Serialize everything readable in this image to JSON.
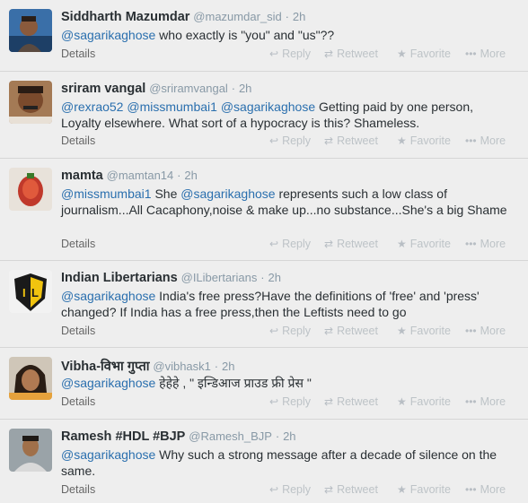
{
  "actions": {
    "details": "Details",
    "reply": "Reply",
    "retweet": "Retweet",
    "favorite": "Favorite",
    "more": "More"
  },
  "tweets": [
    {
      "fullname": "Siddharth Mazumdar",
      "screen": "@mazumdar_sid",
      "sep": "·",
      "time": "2h",
      "mentions": [
        "@sagarikaghose"
      ],
      "body": " who exactly is \"you\" and \"us\"??"
    },
    {
      "fullname": "sriram vangal",
      "screen": "@sriramvangal",
      "sep": "·",
      "time": "2h",
      "mentions": [
        "@rexrao52",
        "@missmumbai1",
        "@sagarikaghose"
      ],
      "body": " Getting paid by one person, Loyalty elsewhere. What sort of a hypocracy is this? Shameless."
    },
    {
      "fullname": "mamta",
      "screen": "@mamtan14",
      "sep": "·",
      "time": "2h",
      "mentions": [
        "@missmumbai1"
      ],
      "body_a": " She ",
      "mention_b": "@sagarikaghose",
      "body": " represents such a low class of journalism...All Cacaphony,noise & make up...no substance...She's a big Shame"
    },
    {
      "fullname": "Indian Libertarians",
      "screen": "@ILibertarians",
      "sep": "·",
      "time": "2h",
      "mentions": [
        "@sagarikaghose"
      ],
      "body": " India's free press?Have the definitions of 'free' and 'press' changed? If India has a free press,then the Leftists need to go"
    },
    {
      "fullname": "Vibha-विभा गुप्ता",
      "screen": "@vibhask1",
      "sep": "·",
      "time": "2h",
      "mentions": [
        "@sagarikaghose"
      ],
      "body": " हेहेहे , \" इन्डिआज प्राउड फ्री प्रेस \""
    },
    {
      "fullname": "Ramesh #HDL #BJP",
      "screen": "@Ramesh_BJP",
      "sep": "·",
      "time": "2h",
      "mentions": [
        "@sagarikaghose"
      ],
      "body": " Why such a strong message after a decade of silence on the same."
    }
  ],
  "icons": {
    "reply": "reply-arrow-icon",
    "retweet": "retweet-arrows-icon",
    "favorite": "star-icon",
    "more": "ellipsis-icon"
  },
  "colors": {
    "mention": "#2a6fae",
    "background": "#eeeeee",
    "action_text": "#bdc3c7"
  }
}
